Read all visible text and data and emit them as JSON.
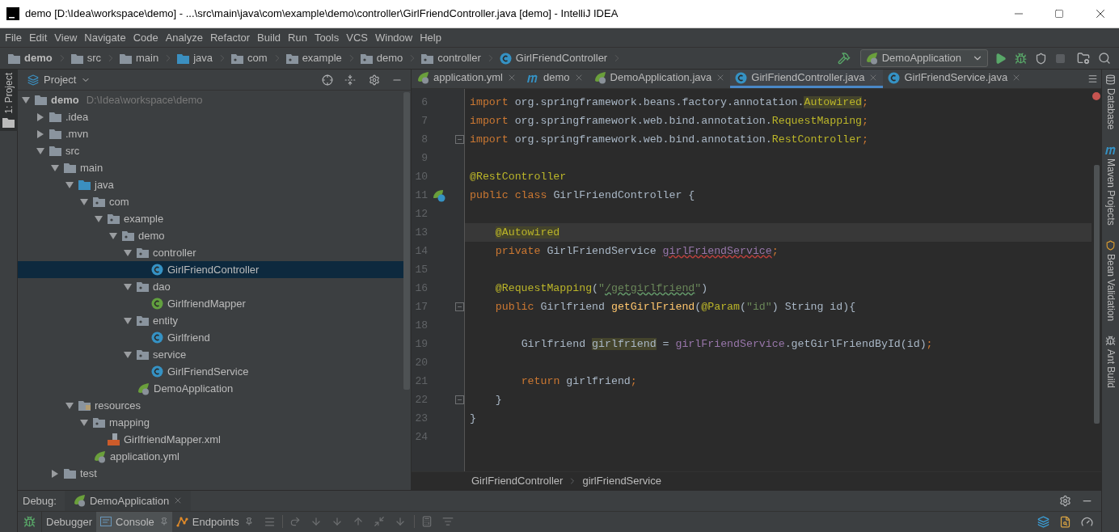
{
  "window": {
    "title": "demo [D:\\Idea\\workspace\\demo] - ...\\src\\main\\java\\com\\example\\demo\\controller\\GirlFriendController.java [demo] - IntelliJ IDEA"
  },
  "menu": [
    "File",
    "Edit",
    "View",
    "Navigate",
    "Code",
    "Analyze",
    "Refactor",
    "Build",
    "Run",
    "Tools",
    "VCS",
    "Window",
    "Help"
  ],
  "navbar": {
    "crumbs": [
      {
        "label": "demo",
        "kind": "module"
      },
      {
        "label": "src",
        "kind": "folder"
      },
      {
        "label": "main",
        "kind": "folder"
      },
      {
        "label": "java",
        "kind": "source"
      },
      {
        "label": "com",
        "kind": "package"
      },
      {
        "label": "example",
        "kind": "package"
      },
      {
        "label": "demo",
        "kind": "package"
      },
      {
        "label": "controller",
        "kind": "package"
      },
      {
        "label": "GirlFriendController",
        "kind": "class"
      }
    ],
    "run_config": "DemoApplication"
  },
  "project_panel": {
    "stripe_label": "1: Project",
    "title": "Project",
    "tree": [
      {
        "label": "demo",
        "path": "D:\\Idea\\workspace\\demo",
        "kind": "module",
        "expanded": true,
        "selected": false,
        "children": [
          {
            "label": ".idea",
            "kind": "folder",
            "expanded": false,
            "selected": false
          },
          {
            "label": ".mvn",
            "kind": "folder",
            "expanded": false,
            "selected": false
          },
          {
            "label": "src",
            "kind": "folder",
            "expanded": true,
            "selected": false,
            "children": [
              {
                "label": "main",
                "kind": "folder",
                "expanded": true,
                "selected": false,
                "children": [
                  {
                    "label": "java",
                    "kind": "source",
                    "expanded": true,
                    "selected": false,
                    "children": [
                      {
                        "label": "com",
                        "kind": "package",
                        "expanded": true,
                        "selected": false,
                        "children": [
                          {
                            "label": "example",
                            "kind": "package",
                            "expanded": true,
                            "selected": false,
                            "children": [
                              {
                                "label": "demo",
                                "kind": "package",
                                "expanded": true,
                                "selected": false,
                                "children": [
                                  {
                                    "label": "controller",
                                    "kind": "package",
                                    "expanded": true,
                                    "selected": false,
                                    "children": [
                                      {
                                        "label": "GirlFriendController",
                                        "kind": "class",
                                        "selected": true
                                      }
                                    ]
                                  },
                                  {
                                    "label": "dao",
                                    "kind": "package",
                                    "expanded": true,
                                    "selected": false,
                                    "children": [
                                      {
                                        "label": "GirlfriendMapper",
                                        "kind": "interface",
                                        "selected": false
                                      }
                                    ]
                                  },
                                  {
                                    "label": "entity",
                                    "kind": "package",
                                    "expanded": true,
                                    "selected": false,
                                    "children": [
                                      {
                                        "label": "Girlfriend",
                                        "kind": "class",
                                        "selected": false
                                      }
                                    ]
                                  },
                                  {
                                    "label": "service",
                                    "kind": "package",
                                    "expanded": true,
                                    "selected": false,
                                    "children": [
                                      {
                                        "label": "GirlFriendService",
                                        "kind": "class",
                                        "selected": false
                                      }
                                    ]
                                  },
                                  {
                                    "label": "DemoApplication",
                                    "kind": "spring",
                                    "selected": false
                                  }
                                ]
                              }
                            ]
                          }
                        ]
                      }
                    ]
                  },
                  {
                    "label": "resources",
                    "kind": "resources",
                    "expanded": true,
                    "selected": false,
                    "children": [
                      {
                        "label": "mapping",
                        "kind": "package",
                        "expanded": true,
                        "selected": false,
                        "children": [
                          {
                            "label": "GirlfriendMapper.xml",
                            "kind": "xml",
                            "selected": false
                          }
                        ]
                      },
                      {
                        "label": "application.yml",
                        "kind": "yml",
                        "selected": false
                      }
                    ]
                  }
                ]
              },
              {
                "label": "test",
                "kind": "folder",
                "expanded": false,
                "selected": false
              }
            ]
          }
        ]
      }
    ]
  },
  "editor": {
    "tabs": [
      {
        "label": "application.yml",
        "kind": "yml",
        "selected": false
      },
      {
        "label": "demo",
        "kind": "maven",
        "selected": false
      },
      {
        "label": "DemoApplication.java",
        "kind": "spring",
        "selected": false
      },
      {
        "label": "GirlFriendController.java",
        "kind": "class",
        "selected": true
      },
      {
        "label": "GirlFriendService.java",
        "kind": "class",
        "selected": false
      }
    ],
    "lines": [
      {
        "number": "6",
        "current": false,
        "fold": false,
        "tokens": [
          {
            "kind": "keyword",
            "text": "import"
          },
          {
            "kind": "plain",
            "text": " org.springframework.beans.factory.annotation."
          },
          {
            "kind": "annotation",
            "text": "Autowired",
            "highlighted": true
          },
          {
            "kind": "keyword",
            "text": ";"
          }
        ]
      },
      {
        "number": "7",
        "current": false,
        "fold": false,
        "tokens": [
          {
            "kind": "keyword",
            "text": "import"
          },
          {
            "kind": "plain",
            "text": " org.springframework.web.bind.annotation."
          },
          {
            "kind": "annotation",
            "text": "RequestMapping"
          },
          {
            "kind": "keyword",
            "text": ";"
          }
        ]
      },
      {
        "number": "8",
        "current": false,
        "fold": true,
        "tokens": [
          {
            "kind": "keyword",
            "text": "import"
          },
          {
            "kind": "plain",
            "text": " org.springframework.web.bind.annotation."
          },
          {
            "kind": "annotation",
            "text": "RestController"
          },
          {
            "kind": "keyword",
            "text": ";"
          }
        ]
      },
      {
        "number": "9",
        "current": false,
        "fold": false
      },
      {
        "number": "10",
        "current": false,
        "fold": false,
        "tokens": [
          {
            "kind": "annotation",
            "text": "@RestController"
          }
        ]
      },
      {
        "number": "11",
        "current": false,
        "fold": false,
        "bean_marker": true,
        "tokens": [
          {
            "kind": "keyword",
            "text": "public class"
          },
          {
            "kind": "plain",
            "text": " GirlFriendController {"
          }
        ]
      },
      {
        "number": "12",
        "current": false,
        "fold": false
      },
      {
        "number": "13",
        "current": true,
        "fold": false,
        "tokens": [
          {
            "kind": "annotation",
            "text": "    @Autowired",
            "highlighted": true
          }
        ]
      },
      {
        "number": "14",
        "current": false,
        "fold": false,
        "tokens": [
          {
            "kind": "keyword",
            "text": "    private"
          },
          {
            "kind": "plain",
            "text": " GirlFriendService "
          },
          {
            "kind": "field",
            "text": "girlFriendService",
            "error_underline": true
          },
          {
            "kind": "keyword",
            "text": ";"
          }
        ]
      },
      {
        "number": "15",
        "current": false,
        "fold": false
      },
      {
        "number": "16",
        "current": false,
        "fold": false,
        "tokens": [
          {
            "kind": "annotation",
            "text": "    @RequestMapping"
          },
          {
            "kind": "plain",
            "text": "("
          },
          {
            "kind": "string",
            "text": "\""
          },
          {
            "kind": "string",
            "text": "/getgirlfriend",
            "typo_underline": true
          },
          {
            "kind": "string",
            "text": "\""
          },
          {
            "kind": "plain",
            "text": ")"
          }
        ]
      },
      {
        "number": "17",
        "current": false,
        "fold": true,
        "tokens": [
          {
            "kind": "keyword",
            "text": "    public"
          },
          {
            "kind": "plain",
            "text": " Girlfriend "
          },
          {
            "kind": "method",
            "text": "getGirlFriend"
          },
          {
            "kind": "plain",
            "text": "("
          },
          {
            "kind": "annotation",
            "text": "@Param"
          },
          {
            "kind": "plain",
            "text": "("
          },
          {
            "kind": "string",
            "text": "\"id\""
          },
          {
            "kind": "plain",
            "text": ") String id){"
          }
        ]
      },
      {
        "number": "18",
        "current": false,
        "fold": false
      },
      {
        "number": "19",
        "current": false,
        "fold": false,
        "tokens": [
          {
            "kind": "plain",
            "text": "        Girlfriend "
          },
          {
            "kind": "plain",
            "text": "girlfriend",
            "highlighted": true
          },
          {
            "kind": "plain",
            "text": " = "
          },
          {
            "kind": "field",
            "text": "girlFriendService"
          },
          {
            "kind": "plain",
            "text": ".getGirlFriendById(id)"
          },
          {
            "kind": "keyword",
            "text": ";"
          }
        ]
      },
      {
        "number": "20",
        "current": false,
        "fold": false
      },
      {
        "number": "21",
        "current": false,
        "fold": false,
        "tokens": [
          {
            "kind": "keyword",
            "text": "        return"
          },
          {
            "kind": "plain",
            "text": " girlfriend"
          },
          {
            "kind": "keyword",
            "text": ";"
          }
        ]
      },
      {
        "number": "22",
        "current": false,
        "fold": true,
        "tokens": [
          {
            "kind": "plain",
            "text": "    }"
          }
        ]
      },
      {
        "number": "23",
        "current": false,
        "fold": false,
        "tokens": [
          {
            "kind": "plain",
            "text": "}"
          }
        ]
      },
      {
        "number": "24",
        "current": false,
        "fold": false
      }
    ],
    "breadcrumb": [
      "GirlFriendController",
      "girlFriendService"
    ]
  },
  "right_stripe": [
    {
      "label": "Database",
      "kind": "database"
    },
    {
      "label": "Maven Projects",
      "kind": "maven"
    },
    {
      "label": "Bean Validation",
      "kind": "bean"
    },
    {
      "label": "Ant Build",
      "kind": "ant"
    }
  ],
  "debug": {
    "label": "Debug:",
    "session_tab": "DemoApplication",
    "tabs": [
      {
        "label": "Debugger",
        "kind": "plain",
        "selected": false
      },
      {
        "label": "Console",
        "kind": "console",
        "selected": true
      },
      {
        "label": "Endpoints",
        "kind": "endpoints",
        "selected": false
      }
    ]
  }
}
